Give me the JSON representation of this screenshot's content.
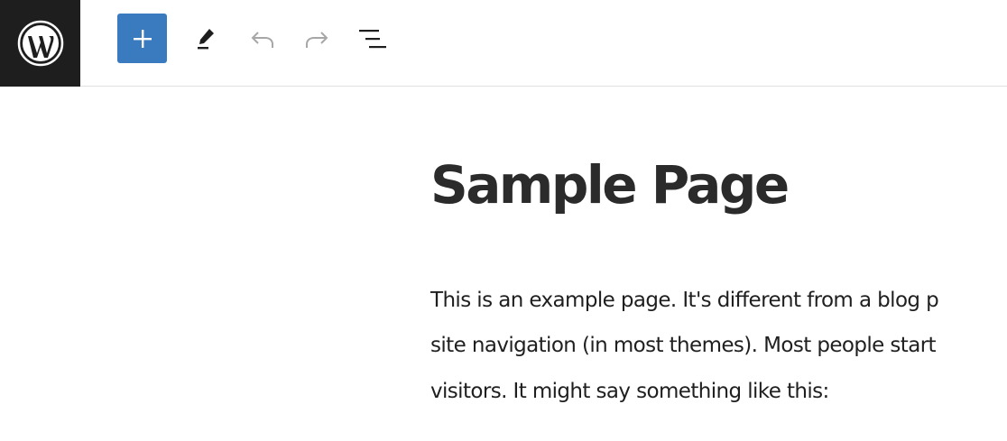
{
  "toolbar": {
    "logo_icon": "wordpress-icon",
    "add_icon": "plus-icon",
    "edit_icon": "pencil-icon",
    "undo_icon": "undo-icon",
    "redo_icon": "redo-icon",
    "outline_icon": "list-view-icon",
    "accent_color": "#3a7bbf",
    "logo_bg": "#1e1e1e"
  },
  "editor": {
    "title": "Sample Page",
    "paragraph_lines": [
      "This is an example page. It's different from a blog p",
      "site navigation (in most themes). Most people start",
      "visitors. It might say something like this:"
    ]
  }
}
